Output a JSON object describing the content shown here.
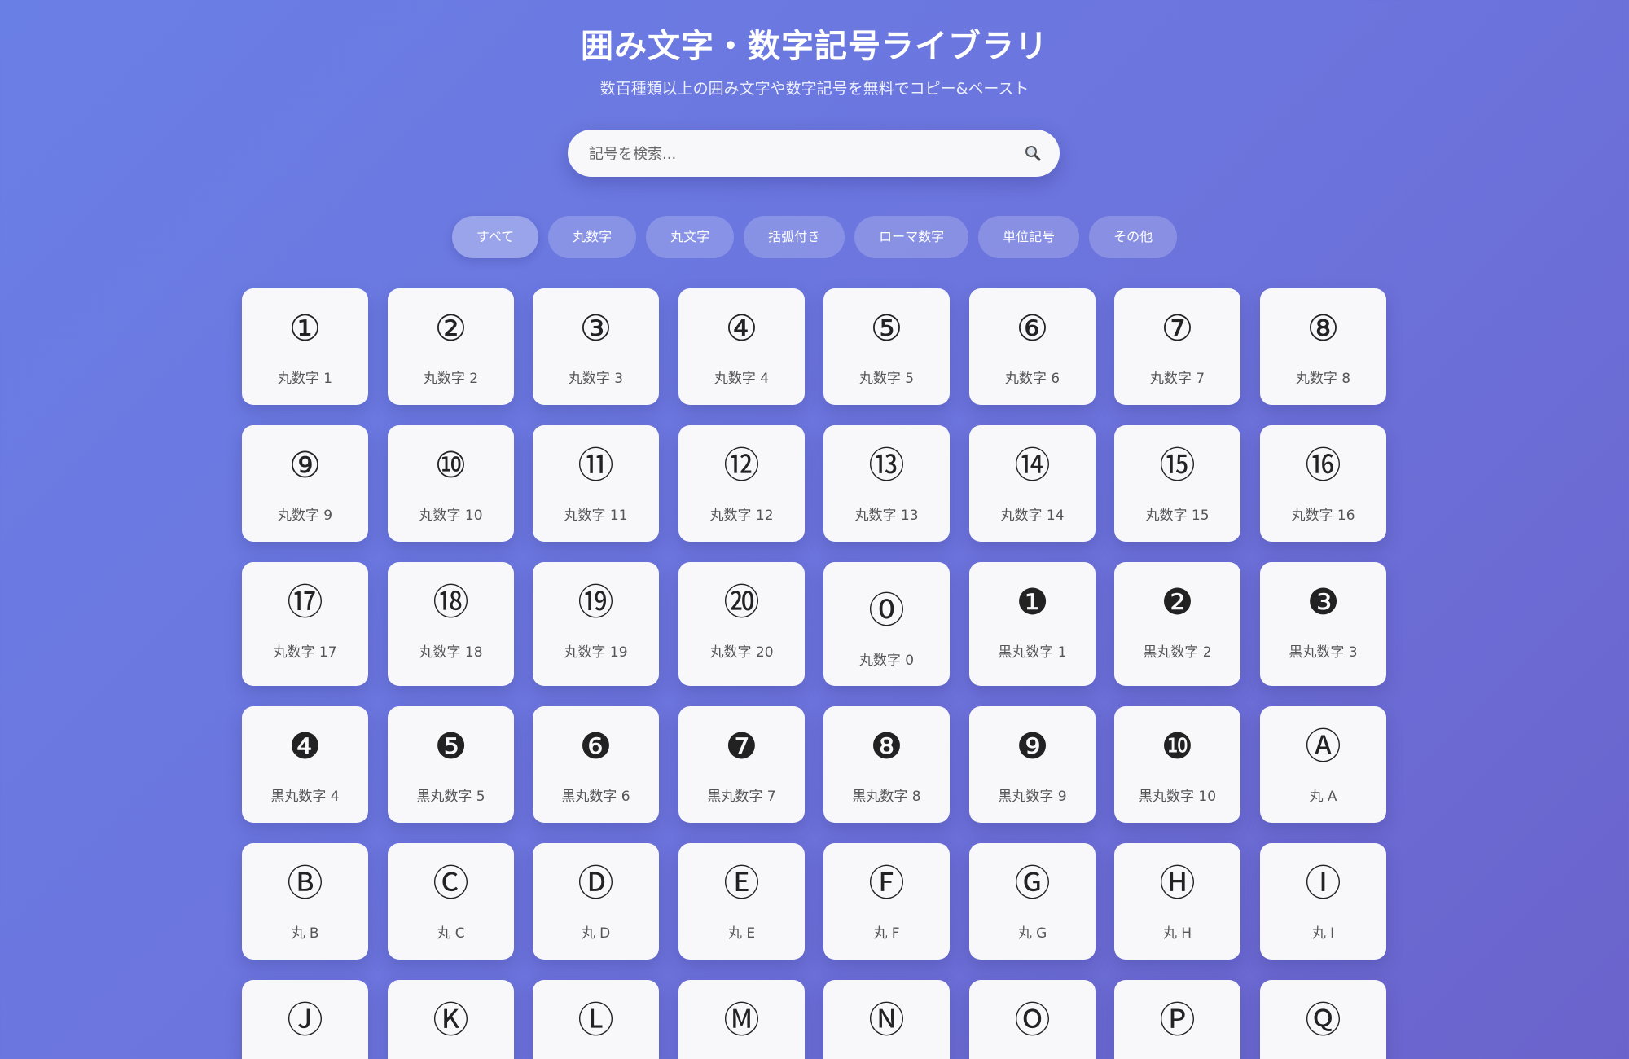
{
  "header": {
    "title": "囲み文字・数字記号ライブラリ",
    "subtitle": "数百種類以上の囲み文字や数字記号を無料でコピー&ペースト"
  },
  "search": {
    "placeholder": "記号を検索...",
    "icon": "magnifier-icon"
  },
  "filters": [
    {
      "label": "すべて",
      "active": true
    },
    {
      "label": "丸数字",
      "active": false
    },
    {
      "label": "丸文字",
      "active": false
    },
    {
      "label": "括弧付き",
      "active": false
    },
    {
      "label": "ローマ数字",
      "active": false
    },
    {
      "label": "単位記号",
      "active": false
    },
    {
      "label": "その他",
      "active": false
    }
  ],
  "symbols": [
    {
      "symbol": "①",
      "name": "丸数字 1"
    },
    {
      "symbol": "②",
      "name": "丸数字 2"
    },
    {
      "symbol": "③",
      "name": "丸数字 3"
    },
    {
      "symbol": "④",
      "name": "丸数字 4"
    },
    {
      "symbol": "⑤",
      "name": "丸数字 5"
    },
    {
      "symbol": "⑥",
      "name": "丸数字 6"
    },
    {
      "symbol": "⑦",
      "name": "丸数字 7"
    },
    {
      "symbol": "⑧",
      "name": "丸数字 8"
    },
    {
      "symbol": "⑨",
      "name": "丸数字 9"
    },
    {
      "symbol": "⑩",
      "name": "丸数字 10"
    },
    {
      "symbol": "⑪",
      "name": "丸数字 11"
    },
    {
      "symbol": "⑫",
      "name": "丸数字 12"
    },
    {
      "symbol": "⑬",
      "name": "丸数字 13"
    },
    {
      "symbol": "⑭",
      "name": "丸数字 14"
    },
    {
      "symbol": "⑮",
      "name": "丸数字 15"
    },
    {
      "symbol": "⑯",
      "name": "丸数字 16"
    },
    {
      "symbol": "⑰",
      "name": "丸数字 17"
    },
    {
      "symbol": "⑱",
      "name": "丸数字 18"
    },
    {
      "symbol": "⑲",
      "name": "丸数字 19"
    },
    {
      "symbol": "⑳",
      "name": "丸数字 20"
    },
    {
      "symbol": "⓪",
      "name": "丸数字 0"
    },
    {
      "symbol": "❶",
      "name": "黒丸数字 1"
    },
    {
      "symbol": "❷",
      "name": "黒丸数字 2"
    },
    {
      "symbol": "❸",
      "name": "黒丸数字 3"
    },
    {
      "symbol": "❹",
      "name": "黒丸数字 4"
    },
    {
      "symbol": "❺",
      "name": "黒丸数字 5"
    },
    {
      "symbol": "❻",
      "name": "黒丸数字 6"
    },
    {
      "symbol": "❼",
      "name": "黒丸数字 7"
    },
    {
      "symbol": "❽",
      "name": "黒丸数字 8"
    },
    {
      "symbol": "❾",
      "name": "黒丸数字 9"
    },
    {
      "symbol": "❿",
      "name": "黒丸数字 10"
    },
    {
      "symbol": "Ⓐ",
      "name": "丸 A"
    },
    {
      "symbol": "Ⓑ",
      "name": "丸 B"
    },
    {
      "symbol": "Ⓒ",
      "name": "丸 C"
    },
    {
      "symbol": "Ⓓ",
      "name": "丸 D"
    },
    {
      "symbol": "Ⓔ",
      "name": "丸 E"
    },
    {
      "symbol": "Ⓕ",
      "name": "丸 F"
    },
    {
      "symbol": "Ⓖ",
      "name": "丸 G"
    },
    {
      "symbol": "Ⓗ",
      "name": "丸 H"
    },
    {
      "symbol": "Ⓘ",
      "name": "丸 I"
    },
    {
      "symbol": "Ⓙ",
      "name": ""
    },
    {
      "symbol": "Ⓚ",
      "name": ""
    },
    {
      "symbol": "Ⓛ",
      "name": ""
    },
    {
      "symbol": "Ⓜ",
      "name": ""
    },
    {
      "symbol": "Ⓝ",
      "name": ""
    },
    {
      "symbol": "Ⓞ",
      "name": ""
    },
    {
      "symbol": "Ⓟ",
      "name": ""
    },
    {
      "symbol": "Ⓠ",
      "name": ""
    }
  ]
}
